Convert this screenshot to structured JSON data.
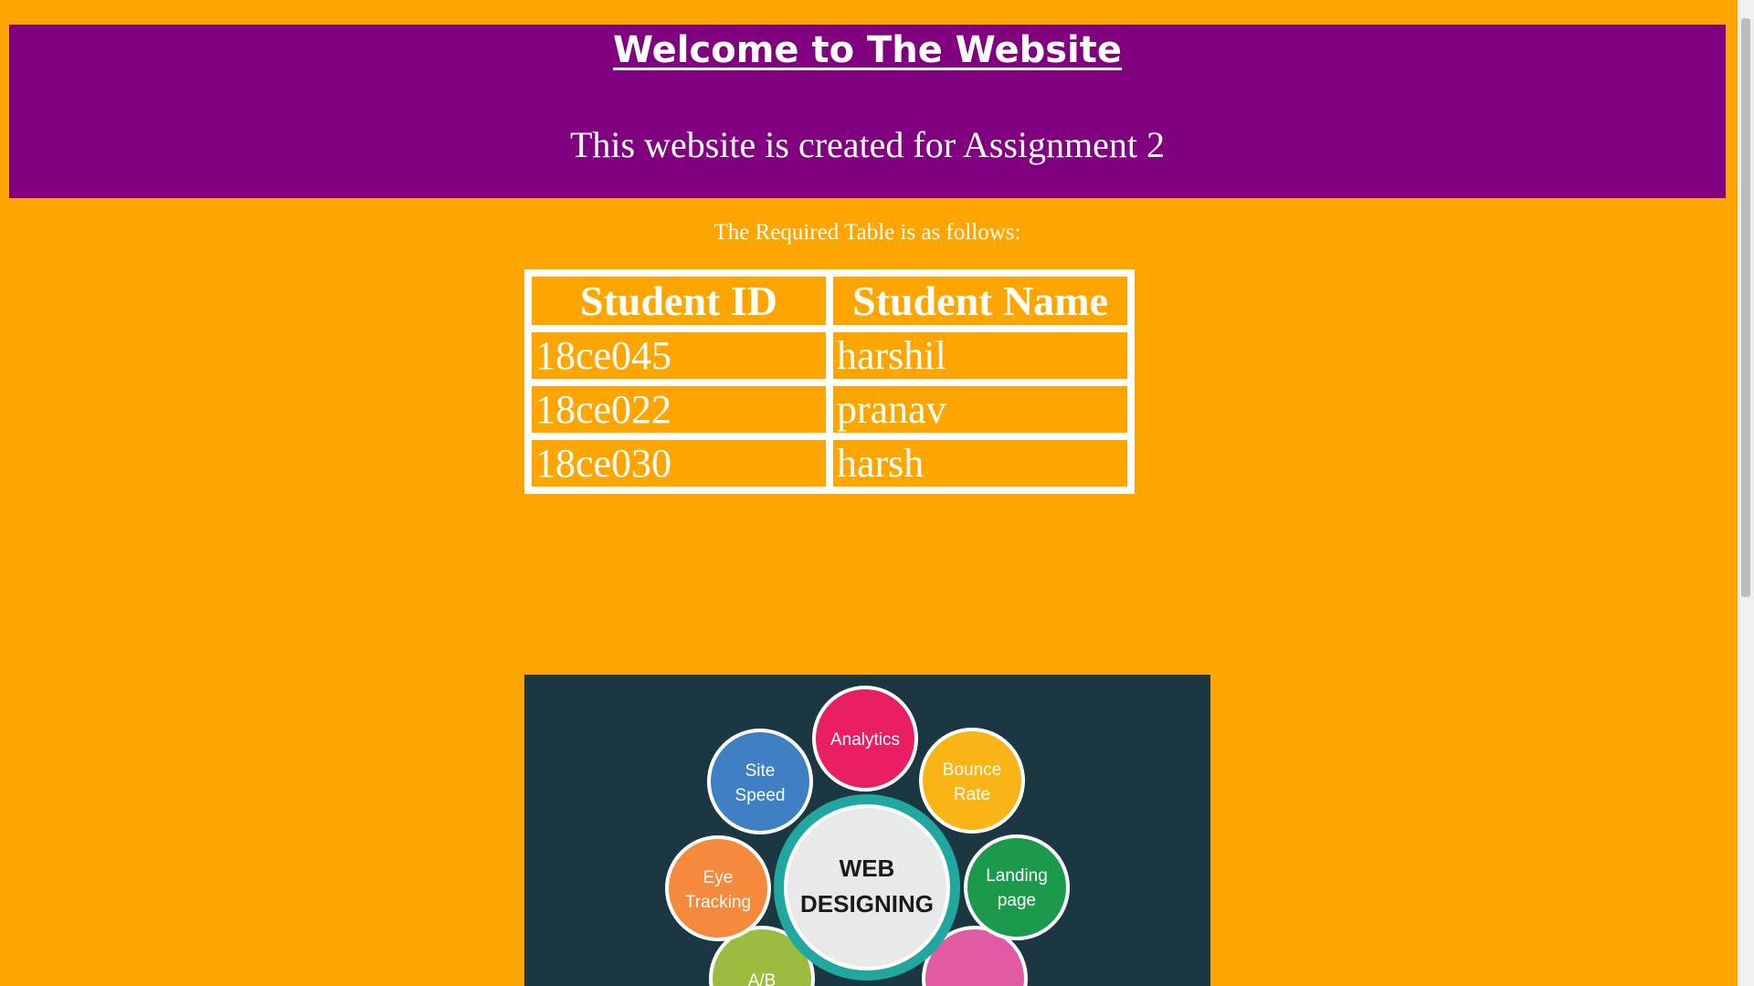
{
  "header": {
    "title": "Welcome to The Website",
    "subtitle": "This website is created for Assignment 2"
  },
  "intro": "The Required Table is as follows:",
  "table": {
    "headers": [
      "Student ID",
      "Student Name"
    ],
    "rows": [
      [
        "18ce045",
        "harshil"
      ],
      [
        "18ce022",
        "pranav"
      ],
      [
        "18ce030",
        "harsh"
      ]
    ]
  },
  "banner": {
    "center": [
      "WEB",
      "DESIGNING"
    ],
    "bubbles": [
      {
        "lines": [
          "Analytics"
        ],
        "color": "#E91E63"
      },
      {
        "lines": [
          "Site",
          "Speed"
        ],
        "color": "#3F7FC4"
      },
      {
        "lines": [
          "Bounce",
          "Rate"
        ],
        "color": "#FBB416"
      },
      {
        "lines": [
          "Eye",
          "Tracking"
        ],
        "color": "#F58A3C"
      },
      {
        "lines": [
          "Landing",
          "page"
        ],
        "color": "#1A9A4A"
      },
      {
        "lines": [
          "A/B"
        ],
        "color": "#9DBB3E"
      },
      {
        "lines": [
          ""
        ],
        "color": "#E35AA4"
      }
    ],
    "ring_color": "#1FA7A0",
    "center_color": "#E8E9E9",
    "background": "#1A3742"
  },
  "colors": {
    "page_background": "#FFA500",
    "header_background": "#800080"
  }
}
